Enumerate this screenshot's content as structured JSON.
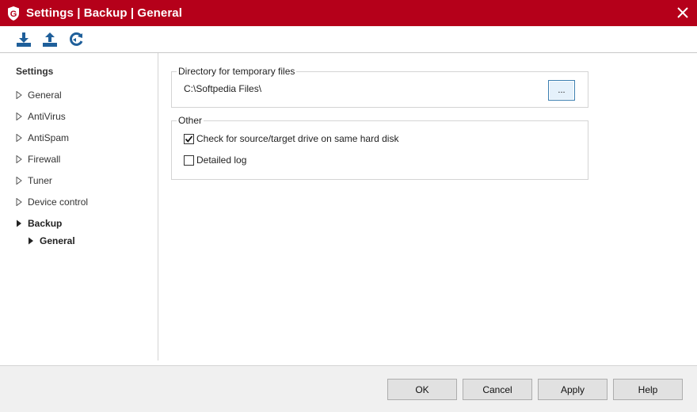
{
  "window": {
    "title": "Settings | Backup | General",
    "close_icon": "close-icon",
    "brand_color": "#b5001a"
  },
  "toolbar": {
    "icons": [
      "import-icon",
      "export-icon",
      "reset-defaults-icon"
    ]
  },
  "sidebar": {
    "heading": "Settings",
    "items": [
      {
        "label": "General",
        "active": false
      },
      {
        "label": "AntiVirus",
        "active": false
      },
      {
        "label": "AntiSpam",
        "active": false
      },
      {
        "label": "Firewall",
        "active": false
      },
      {
        "label": "Tuner",
        "active": false
      },
      {
        "label": "Device control",
        "active": false
      },
      {
        "label": "Backup",
        "active": true
      }
    ],
    "subitems": [
      {
        "label": "General",
        "active": true
      }
    ]
  },
  "main": {
    "temp_dir_group": {
      "label": "Directory for temporary files",
      "path": "C:\\Softpedia Files\\",
      "browse_label": "..."
    },
    "other_group": {
      "label": "Other",
      "options": [
        {
          "label": "Check for source/target drive on same hard disk",
          "checked": true
        },
        {
          "label": "Detailed log",
          "checked": false
        }
      ]
    }
  },
  "footer": {
    "ok_label": "OK",
    "cancel_label": "Cancel",
    "apply_label": "Apply",
    "help_label": "Help"
  }
}
